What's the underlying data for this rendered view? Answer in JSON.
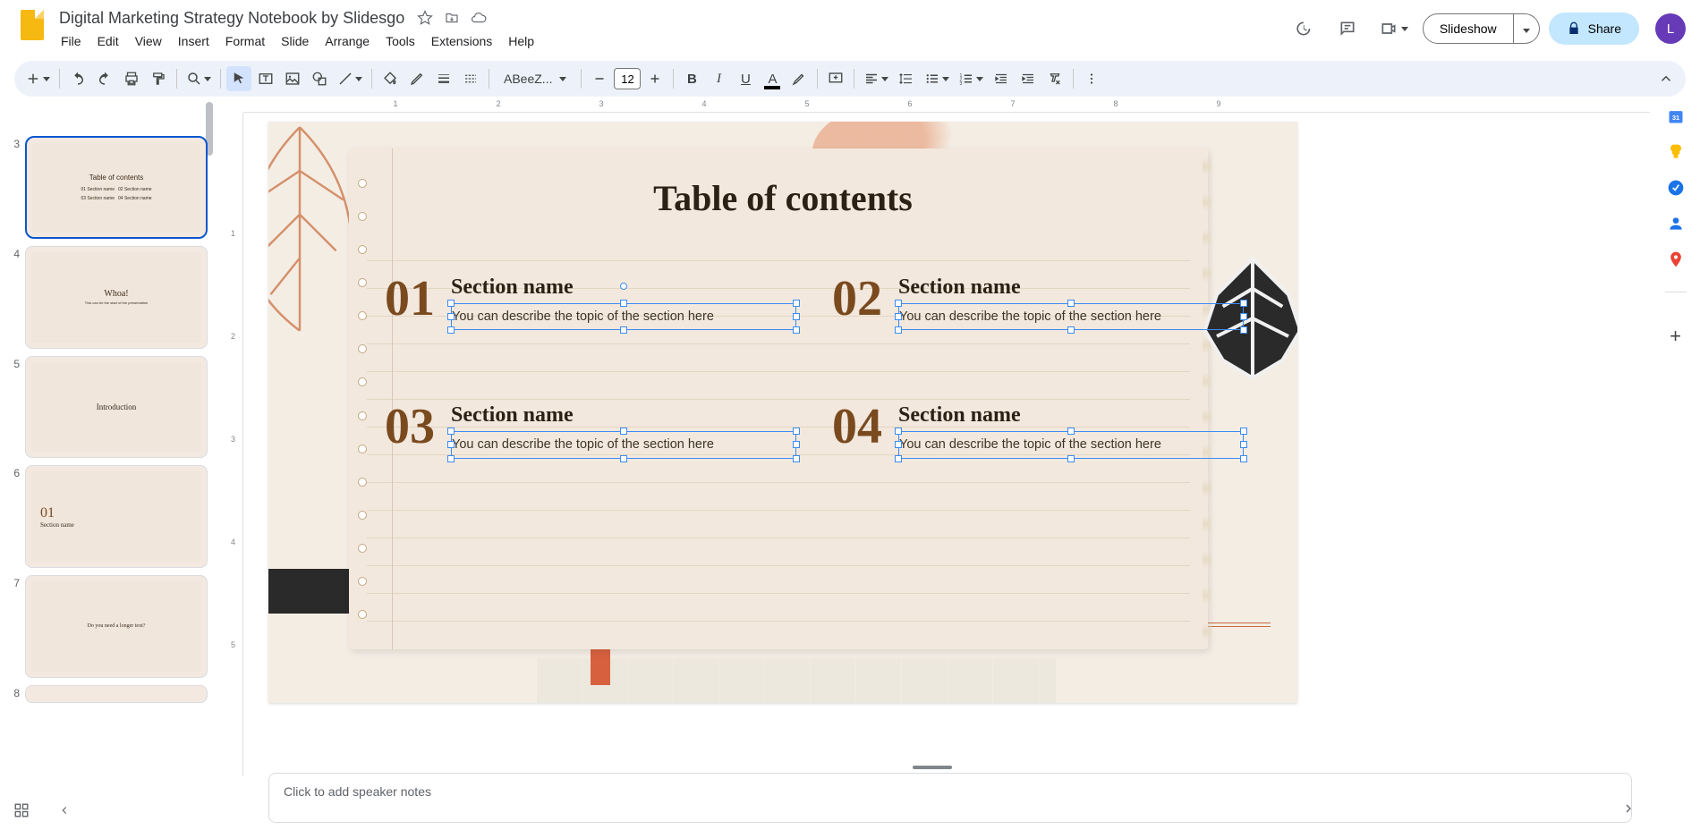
{
  "header": {
    "doc_title": "Digital Marketing Strategy Notebook by Slidesgo",
    "slideshow_label": "Slideshow",
    "share_label": "Share",
    "avatar_initial": "L"
  },
  "menubar": [
    "File",
    "Edit",
    "View",
    "Insert",
    "Format",
    "Slide",
    "Arrange",
    "Tools",
    "Extensions",
    "Help"
  ],
  "toolbar": {
    "font_name": "ABeeZ...",
    "font_size": "12"
  },
  "ruler_marks": [
    "1",
    "2",
    "3",
    "4",
    "5",
    "6",
    "7",
    "8",
    "9"
  ],
  "filmstrip": {
    "visible_slides": [
      {
        "num": "3",
        "selected": true,
        "title": "Table of contents"
      },
      {
        "num": "4",
        "selected": false,
        "title": "Whoa!"
      },
      {
        "num": "5",
        "selected": false,
        "title": "Introduction"
      },
      {
        "num": "6",
        "selected": false,
        "title": "01 Section name"
      },
      {
        "num": "7",
        "selected": false,
        "title": "Do you need a longer text?"
      },
      {
        "num": "8",
        "selected": false,
        "title": ""
      }
    ]
  },
  "slide": {
    "title": "Table of contents",
    "toc": [
      {
        "num": "01",
        "name": "Section name",
        "desc": "You can describe the topic of the section here"
      },
      {
        "num": "02",
        "name": "Section name",
        "desc": "You can describe the topic of the section here"
      },
      {
        "num": "03",
        "name": "Section name",
        "desc": "You can describe the topic of the section here"
      },
      {
        "num": "04",
        "name": "Section name",
        "desc": "You can describe the topic of the section here"
      }
    ]
  },
  "speaker_notes_placeholder": "Click to add speaker notes",
  "side_panel": {
    "calendar_color": "#4285f4",
    "keep_color": "#fbbc04",
    "tasks_color": "#1a73e8",
    "contacts_color": "#1a73e8",
    "maps_color": "#ea4335"
  }
}
